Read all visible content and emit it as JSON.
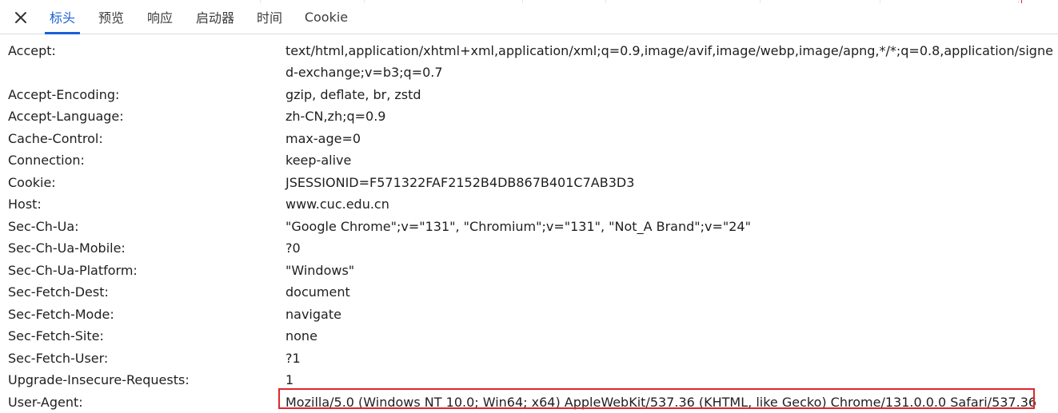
{
  "tabs": [
    {
      "label": "标头",
      "active": true
    },
    {
      "label": "预览",
      "active": false
    },
    {
      "label": "响应",
      "active": false
    },
    {
      "label": "启动器",
      "active": false
    },
    {
      "label": "时间",
      "active": false
    },
    {
      "label": "Cookie",
      "active": false
    }
  ],
  "close_icon": "close-icon",
  "accent_color": "#1a5fd6",
  "highlight_color": "#e0262c",
  "headers": [
    {
      "name": "Accept:",
      "value": "text/html,application/xhtml+xml,application/xml;q=0.9,image/avif,image/webp,image/apng,*/*;q=0.8,application/signed-exchange;v=b3;q=0.7"
    },
    {
      "name": "Accept-Encoding:",
      "value": "gzip, deflate, br, zstd"
    },
    {
      "name": "Accept-Language:",
      "value": "zh-CN,zh;q=0.9"
    },
    {
      "name": "Cache-Control:",
      "value": "max-age=0"
    },
    {
      "name": "Connection:",
      "value": "keep-alive"
    },
    {
      "name": "Cookie:",
      "value": "JSESSIONID=F571322FAF2152B4DB867B401C7AB3D3"
    },
    {
      "name": "Host:",
      "value": "www.cuc.edu.cn"
    },
    {
      "name": "Sec-Ch-Ua:",
      "value": "\"Google Chrome\";v=\"131\", \"Chromium\";v=\"131\", \"Not_A Brand\";v=\"24\""
    },
    {
      "name": "Sec-Ch-Ua-Mobile:",
      "value": "?0"
    },
    {
      "name": "Sec-Ch-Ua-Platform:",
      "value": "\"Windows\""
    },
    {
      "name": "Sec-Fetch-Dest:",
      "value": "document"
    },
    {
      "name": "Sec-Fetch-Mode:",
      "value": "navigate"
    },
    {
      "name": "Sec-Fetch-Site:",
      "value": "none"
    },
    {
      "name": "Sec-Fetch-User:",
      "value": "?1"
    },
    {
      "name": "Upgrade-Insecure-Requests:",
      "value": "1"
    },
    {
      "name": "User-Agent:",
      "value": "Mozilla/5.0 (Windows NT 10.0; Win64; x64) AppleWebKit/537.36 (KHTML, like Gecko) Chrome/131.0.0.0 Safari/537.36"
    }
  ]
}
